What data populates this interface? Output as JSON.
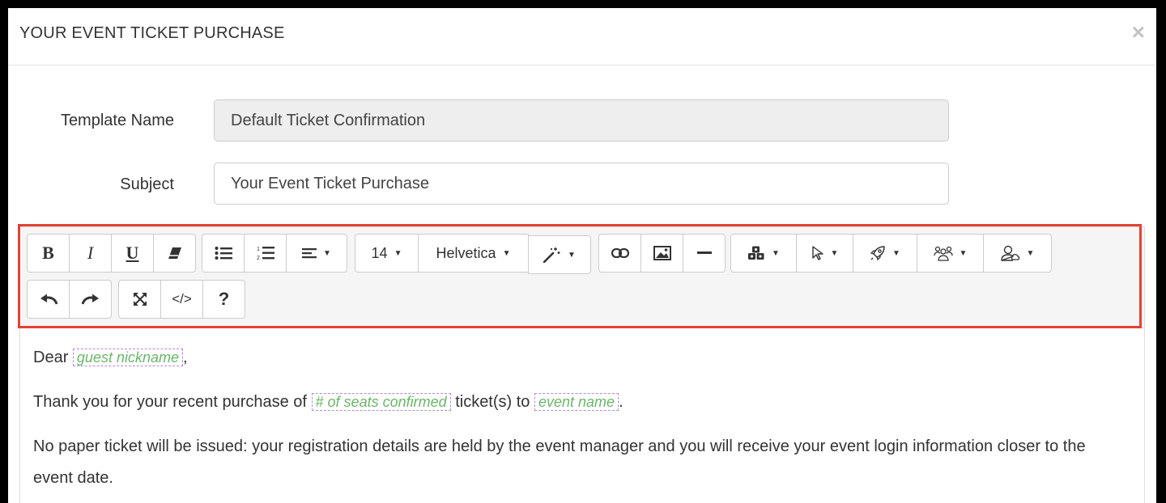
{
  "modal": {
    "title": "YOUR EVENT TICKET PURCHASE",
    "close_label": "×"
  },
  "form": {
    "template_name_label": "Template Name",
    "template_name_value": "Default Ticket Confirmation",
    "subject_label": "Subject",
    "subject_value": "Your Event Ticket Purchase"
  },
  "toolbar": {
    "bold": "B",
    "italic": "I",
    "underline": "U",
    "font_size": "14",
    "font_name": "Helvetica",
    "code": "</>",
    "help": "?"
  },
  "icons": [
    "bold-icon",
    "italic-icon",
    "underline-icon",
    "eraser-icon",
    "bullet-list-icon",
    "numbered-list-icon",
    "align-icon",
    "magic-wand-icon",
    "link-icon",
    "image-icon",
    "horizontal-rule-icon",
    "cubes-icon",
    "pointer-icon",
    "rocket-icon",
    "users-icon",
    "user-icon",
    "undo-icon",
    "redo-icon",
    "fullscreen-icon",
    "code-icon",
    "help-icon"
  ],
  "accent_color": "#e34234",
  "body": {
    "dear": "Dear",
    "token_nickname": "guest nickname",
    "comma": ",",
    "thanks_prefix": "Thank you for your recent purchase of",
    "token_seats": "# of seats confirmed",
    "tickets_to": "ticket(s) to",
    "token_event": "event name",
    "period": ".",
    "paragraph3": "No paper ticket will be issued: your registration details are held by the event manager and you will receive your event login information closer to the event date."
  }
}
